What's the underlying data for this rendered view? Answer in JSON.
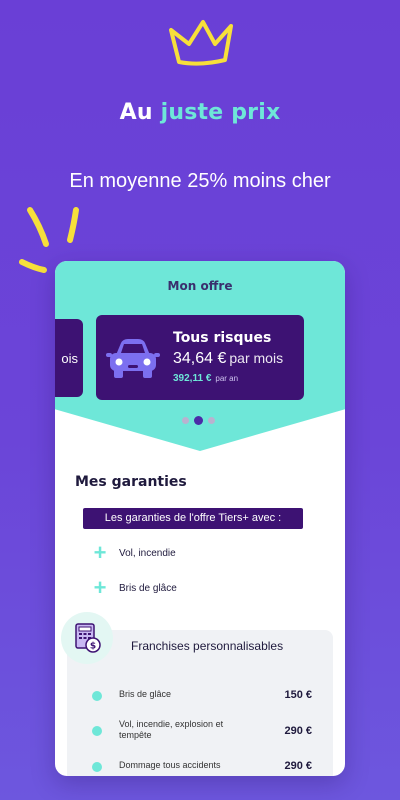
{
  "headline": {
    "part1": "Au ",
    "accent": "juste prix"
  },
  "subtitle": "En moyenne 25% moins cher",
  "colors": {
    "background": "#6a3fd6",
    "accent": "#6ee7d8",
    "dark_purple": "#3d1273",
    "crown": "#f7df3b"
  },
  "icons": {
    "crown": "crown-icon",
    "car": "car-icon",
    "plus": "plus-icon",
    "franchise": "document-coins-icon"
  },
  "offer": {
    "title": "Mon offre",
    "prev_card_text": "ois",
    "card": {
      "title": "Tous risques",
      "price_monthly": "34,64 €",
      "per_month": "par mois",
      "price_annual": "392,11 €",
      "per_year": "par an"
    },
    "carousel": {
      "count": 3,
      "active": 1
    }
  },
  "guarantees": {
    "title": "Mes garanties",
    "banner": "Les garanties de l'offre Tiers+ avec :",
    "items": [
      {
        "label": "Vol, incendie"
      },
      {
        "label": "Bris de glâce"
      }
    ]
  },
  "franchises": {
    "title": "Franchises personnalisables",
    "rows": [
      {
        "label": "Bris de glâce",
        "amount": "150 €"
      },
      {
        "label": "Vol, incendie, explosion et tempête",
        "amount": "290 €"
      },
      {
        "label": "Dommage tous accidents",
        "amount": "290 €"
      }
    ]
  }
}
